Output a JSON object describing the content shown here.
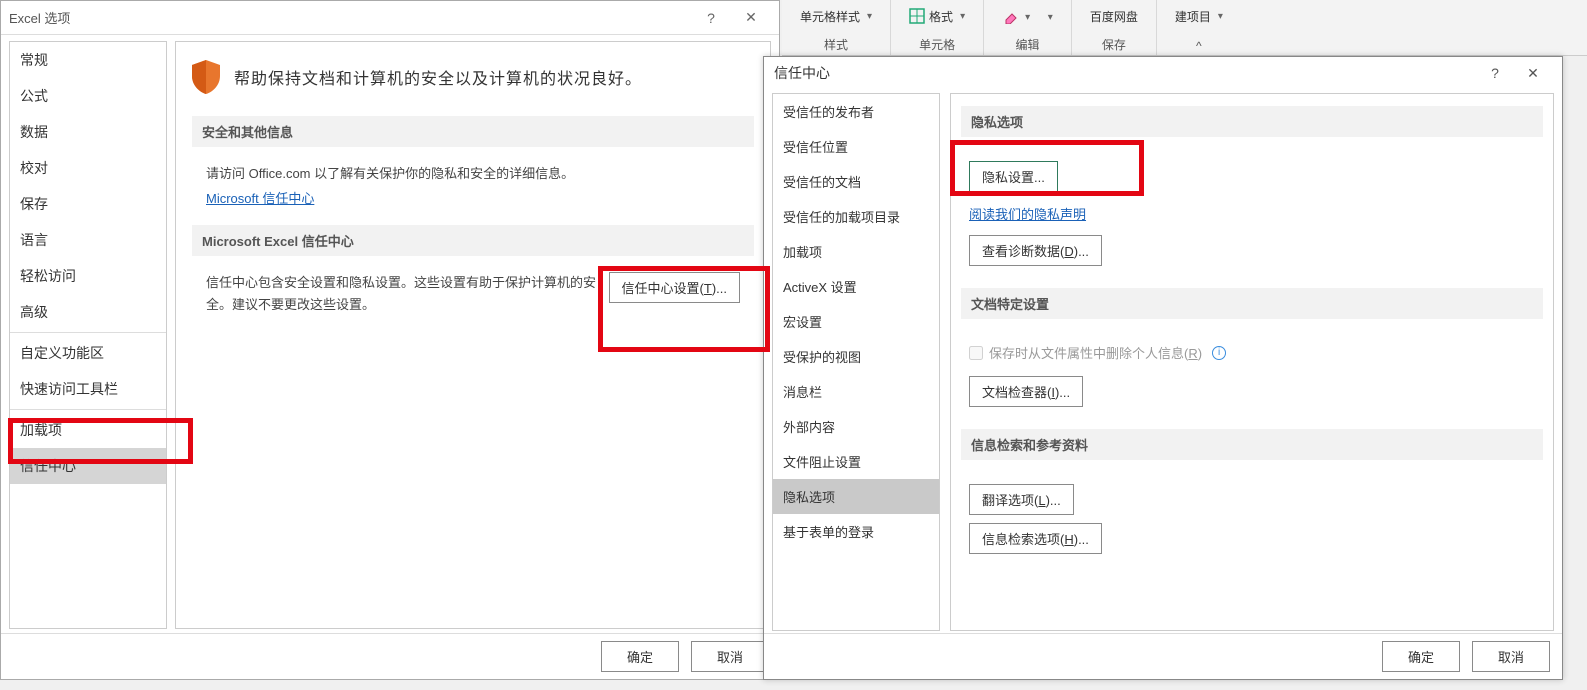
{
  "ribbon": {
    "groups": [
      {
        "top": "单元格样式",
        "label": "样式",
        "dd": true,
        "icon": "cell-styles"
      },
      {
        "top": "格式",
        "label": "单元格",
        "dd": true,
        "icon": "format"
      },
      {
        "top": "",
        "label": "编辑",
        "dd": true,
        "icon": "eraser"
      },
      {
        "top": "百度网盘",
        "label": "保存",
        "dd": false,
        "icon": "cloud"
      },
      {
        "top": "建项目",
        "label": "",
        "dd": true,
        "icon": "project"
      }
    ]
  },
  "options": {
    "title": "Excel 选项",
    "nav": [
      "常规",
      "公式",
      "数据",
      "校对",
      "保存",
      "语言",
      "轻松访问",
      "高级",
      "自定义功能区",
      "快速访问工具栏",
      "加载项",
      "信任中心"
    ],
    "selectedIndex": 11,
    "hero": "帮助保持文档和计算机的安全以及计算机的状况良好。",
    "sec1_head": "安全和其他信息",
    "sec1_text": "请访问 Office.com  以了解有关保护你的隐私和安全的详细信息。",
    "sec1_link": "Microsoft 信任中心",
    "sec2_head": "Microsoft Excel 信任中心",
    "sec2_text": "信任中心包含安全设置和隐私设置。这些设置有助于保护计算机的安全。建议不要更改这些设置。",
    "sec2_btn": "信任中心设置(T)...",
    "ok": "确定",
    "cancel": "取消"
  },
  "trust": {
    "title": "信任中心",
    "nav": [
      "受信任的发布者",
      "受信任位置",
      "受信任的文档",
      "受信任的加载项目录",
      "加载项",
      "ActiveX 设置",
      "宏设置",
      "受保护的视图",
      "消息栏",
      "外部内容",
      "文件阻止设置",
      "隐私选项",
      "基于表单的登录"
    ],
    "selectedIndex": 11,
    "sec_privacy_head": "隐私选项",
    "btn_privacy": "隐私设置...",
    "link_privacy_stmt": "阅读我们的隐私声明",
    "btn_diag": "查看诊断数据(D)...",
    "sec_doc_head": "文档特定设置",
    "chk_remove": "保存时从文件属性中删除个人信息(R)",
    "btn_inspector": "文档检查器(I)...",
    "sec_research_head": "信息检索和参考资料",
    "btn_translate": "翻译选项(L)...",
    "btn_research": "信息检索选项(H)...",
    "ok": "确定",
    "cancel": "取消"
  }
}
